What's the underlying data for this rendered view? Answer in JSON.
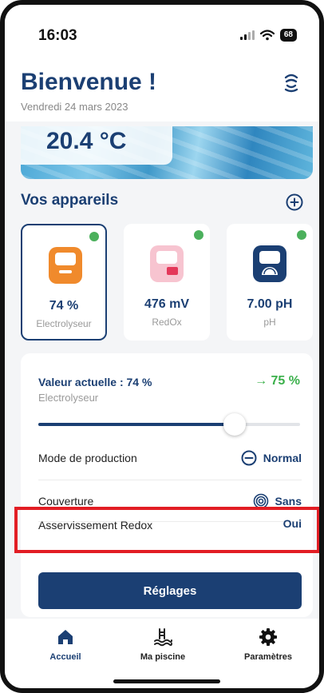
{
  "status_bar": {
    "time": "16:03",
    "battery": "68"
  },
  "header": {
    "title": "Bienvenue !",
    "date": "Vendredi 24 mars 2023"
  },
  "banner": {
    "temperature": "20.4 °C"
  },
  "devices": {
    "title": "Vos appareils",
    "cards": [
      {
        "value": "74 %",
        "label": "Electrolyseur",
        "icon": "electrolyser-icon",
        "color": "#f08a2c",
        "status_color": "#4bb05c"
      },
      {
        "value": "476 mV",
        "label": "RedOx",
        "icon": "redox-icon",
        "color": "#f2a4b6",
        "status_color": "#4bb05c"
      },
      {
        "value": "7.00 pH",
        "label": "pH",
        "icon": "ph-icon",
        "color": "#1b3f73",
        "status_color": "#4bb05c"
      }
    ]
  },
  "detail": {
    "title": "Valeur actuelle : 74 %",
    "subtitle": "Electrolyseur",
    "target": "→ 75 %",
    "slider_level_percent": 75,
    "rows": [
      {
        "label": "Mode de production",
        "value": "Normal",
        "icon": "minus-circle-icon"
      },
      {
        "label": "Couverture",
        "value": "Sans",
        "icon": "spiral-icon"
      },
      {
        "label": "Asservissement Redox",
        "value": "Oui"
      }
    ],
    "button": "Réglages"
  },
  "nav": [
    {
      "label": "Accueil",
      "icon": "home-icon",
      "active": true
    },
    {
      "label": "Ma piscine",
      "icon": "pool-icon",
      "active": false
    },
    {
      "label": "Paramètres",
      "icon": "gear-icon",
      "active": false
    }
  ],
  "colors": {
    "primary": "#1b3f73",
    "accent_green": "#3bb04b",
    "highlight_red": "#e21d24"
  }
}
